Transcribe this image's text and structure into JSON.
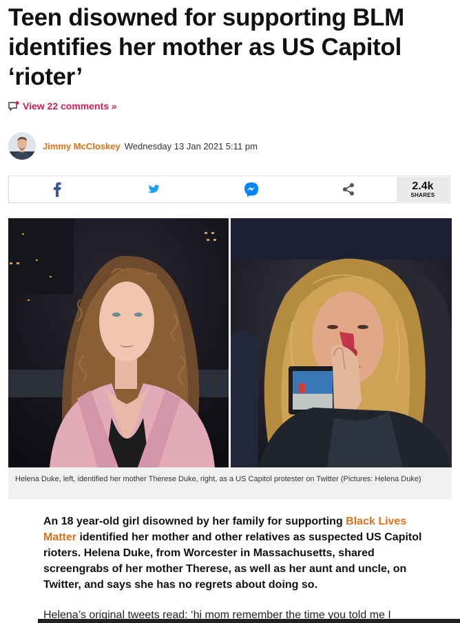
{
  "article": {
    "headline": "Teen disowned for supporting BLM identifies her mother as US Capitol ‘rioter’",
    "comments_link": "View 22 comments »",
    "author": "Jimmy McCloskey",
    "date": "Wednesday 13 Jan 2021 5:11 pm",
    "share": {
      "count": "2.4k",
      "label": "SHARES",
      "buttons": [
        "facebook-icon",
        "twitter-icon",
        "messenger-icon",
        "share-icon"
      ]
    },
    "caption": "Helena Duke, left, identified her mother Therese Duke, right, as a US Capitol protester on Twitter (Pictures: Helena Duke)",
    "lede_part1": "An 18 year-old girl disowned by her family for supporting ",
    "lede_link": "Black Lives Matter",
    "lede_part2": " identified her mother and other relatives as suspected US Capitol rioters. Helena Duke, from Worcester in Massachusetts, shared screengrabs of her mother Therese, as well as her aunt and uncle, on Twitter, and says she has no regrets about doing so.",
    "body_start": "Helena’s original tweets read: ‘hi mom remember the time you told me I"
  },
  "colors": {
    "comments": "#d21f5a",
    "author": "#e0701a",
    "facebook": "#3b5998",
    "twitter": "#1da1f2",
    "messenger": "#0084ff",
    "share": "#555555"
  }
}
